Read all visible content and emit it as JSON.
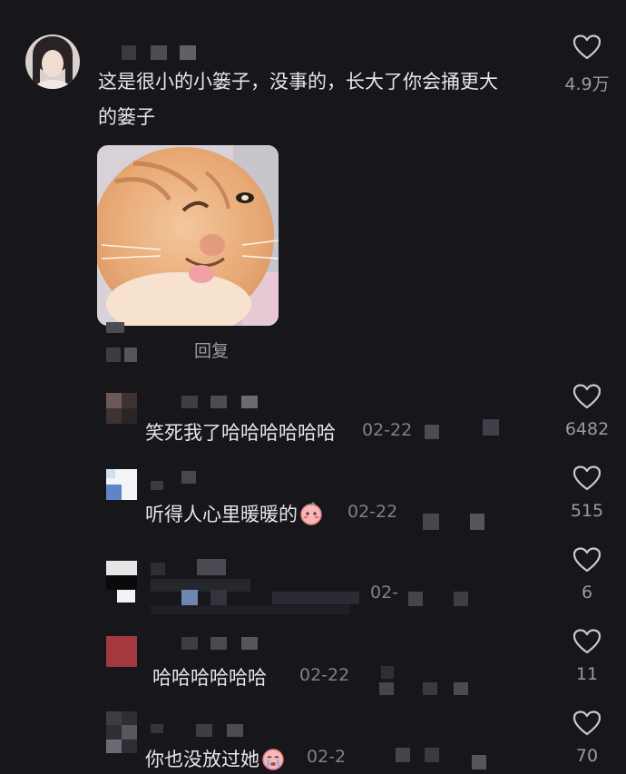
{
  "main_comment": {
    "text_line1": "这是很小的小篓子，没事的，长大了你会捅更大",
    "text_line2": "的篓子",
    "likes": "4.9万",
    "reply_label": "回复"
  },
  "replies": [
    {
      "text": "笑死我了哈哈哈哈哈哈",
      "date": "02-22",
      "likes": "6482"
    },
    {
      "text": "听得人心里暖暖的",
      "date": "02-22",
      "likes": "515"
    },
    {
      "text": "",
      "date": "02-",
      "likes": "6"
    },
    {
      "text": "哈哈哈哈哈哈",
      "date": "02-22",
      "likes": "11"
    },
    {
      "text": "你也没放过她",
      "date": "02-2",
      "likes": "70"
    }
  ],
  "colors": {
    "background": "#17161b",
    "text": "#e6e6ea",
    "meta": "#808088"
  }
}
